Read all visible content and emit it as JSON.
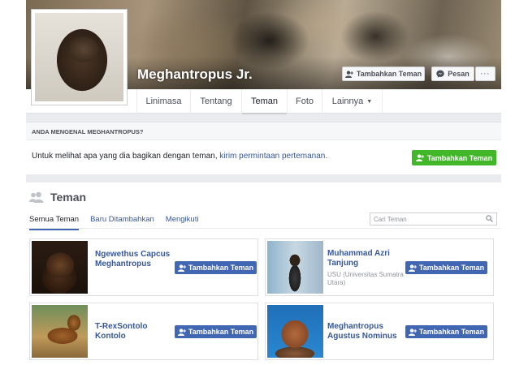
{
  "profile": {
    "name": "Meghantropus Jr."
  },
  "cover_buttons": {
    "add_friend": "Tambahkan Teman",
    "message": "Pesan",
    "more": "···"
  },
  "tabs": [
    {
      "label": "Linimasa"
    },
    {
      "label": "Tentang"
    },
    {
      "label": "Teman"
    },
    {
      "label": "Foto"
    },
    {
      "label": "Lainnya"
    }
  ],
  "know_section": {
    "heading": "ANDA MENGENAL MEGHANTROPUS?",
    "text": "Untuk melihat apa yang dia bagikan dengan teman, ",
    "link": "kirim permintaan pertemanan.",
    "button": "Tambahkan Teman"
  },
  "friends_panel": {
    "title": "Teman",
    "subtabs": [
      {
        "label": "Semua Teman"
      },
      {
        "label": "Baru Ditambahkan"
      },
      {
        "label": "Mengikuti"
      }
    ],
    "search_placeholder": "Cari Teman",
    "friends": [
      {
        "name": "Ngewethus Capcus Meghantropus",
        "sub": "",
        "button": "Tambahkan Teman"
      },
      {
        "name": "Muhammad Azri Tanjung",
        "sub": "USU (Universitas Sumatra Utara)",
        "button": "Tambahkan Teman"
      },
      {
        "name": "T-RexSontolo Kontolo",
        "sub": "",
        "button": "Tambahkan Teman"
      },
      {
        "name": "Meghantropus Agustus Nominus",
        "sub": "",
        "button": "Tambahkan Teman"
      }
    ]
  },
  "colors": {
    "fb_blue": "#4267b2",
    "link_blue": "#365899",
    "green": "#42b72a",
    "gray_bg": "#e9ebee"
  }
}
